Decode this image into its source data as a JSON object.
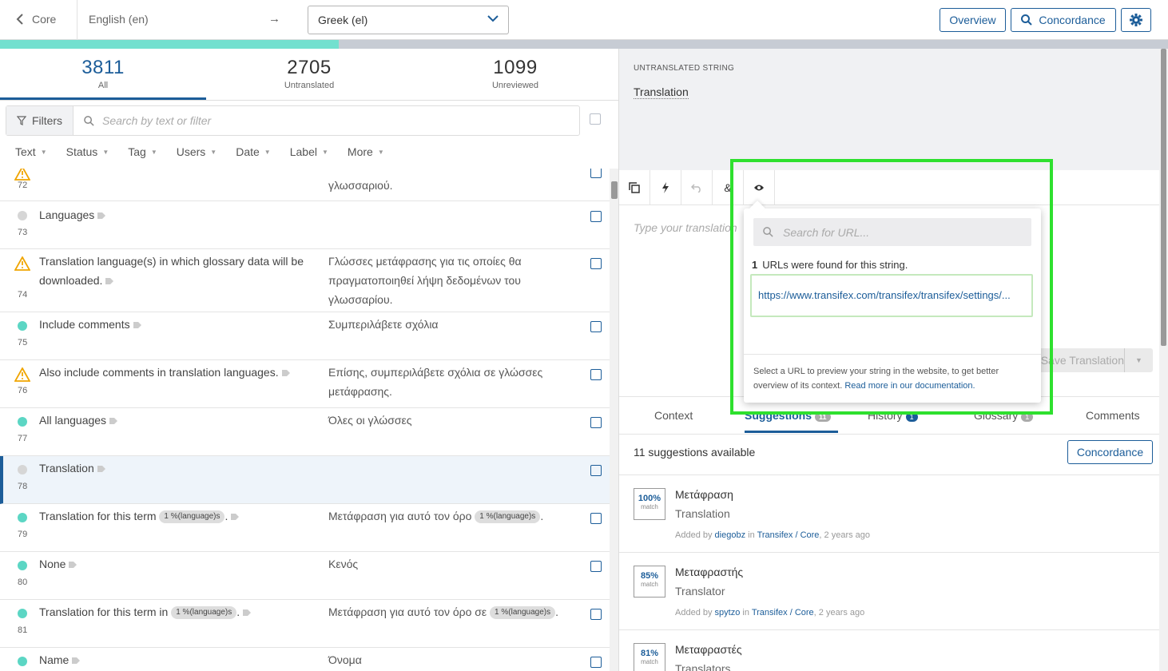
{
  "header": {
    "back_label": "Core",
    "source_language": "English (en)",
    "arrow": "→",
    "target_language": "Greek (el)",
    "overview_label": "Overview",
    "concordance_label": "Concordance"
  },
  "progress": {
    "translated_fraction": 0.29
  },
  "stats": [
    {
      "value": "3811",
      "label": "All"
    },
    {
      "value": "2705",
      "label": "Untranslated"
    },
    {
      "value": "1099",
      "label": "Unreviewed"
    }
  ],
  "filters": {
    "button_label": "Filters",
    "search_placeholder": "Search by text or filter"
  },
  "facets": [
    "Text",
    "Status",
    "Tag",
    "Users",
    "Date",
    "Label",
    "More"
  ],
  "rows": [
    {
      "index": "72",
      "status": "warning",
      "source": "",
      "target": "γλωσσαριού."
    },
    {
      "index": "73",
      "status": "none",
      "source": "Languages",
      "target": ""
    },
    {
      "index": "74",
      "status": "warning",
      "source": "Translation language(s) in which glossary data will be downloaded.",
      "target": "Γλώσσες μετάφρασης για τις οποίες θα πραγματοποιηθεί λήψη δεδομένων του γλωσσαρίου."
    },
    {
      "index": "75",
      "status": "translated",
      "source": "Include comments",
      "target": "Συμπεριλάβετε σχόλια"
    },
    {
      "index": "76",
      "status": "warning",
      "source": "Also include comments in translation languages.",
      "target": "Επίσης, συμπεριλάβετε σχόλια σε γλώσσες μετάφρασης."
    },
    {
      "index": "77",
      "status": "translated",
      "source": "All languages",
      "target": "Όλες οι γλώσσες"
    },
    {
      "index": "78",
      "status": "none",
      "source": "Translation",
      "target": ""
    },
    {
      "index": "79",
      "status": "translated",
      "source": "Translation for this term",
      "source_ph": "1 %(language)s",
      "source_tail": ".",
      "target": "Μετάφραση για αυτό τον όρο",
      "target_ph": "1 %(language)s",
      "target_tail": "."
    },
    {
      "index": "80",
      "status": "translated",
      "source": "None",
      "target": "Κενός"
    },
    {
      "index": "81",
      "status": "translated",
      "source": "Translation for this term in",
      "source_ph": "1 %(language)s",
      "source_tail": ".",
      "target": "Μετάφραση για αυτό τον όρο σε",
      "target_ph": "1 %(language)s",
      "target_tail": "."
    },
    {
      "index": "",
      "status": "translated",
      "source": "Name",
      "target": "Όνομα"
    }
  ],
  "editor": {
    "source_caption": "UNTRANSLATED STRING",
    "source_text": "Translation",
    "translation_placeholder": "Type your translation",
    "save_label": "Save Translation"
  },
  "popover": {
    "search_placeholder": "Search for URL...",
    "found_count": "1",
    "found_text": "URLs were found for this string.",
    "url": "https://www.transifex.com/transifex/transifex/settings/...",
    "footer_text": "Select a URL to preview your string in the website, to get better overview of its context.",
    "footer_link": "Read more in our documentation."
  },
  "tabs": [
    {
      "label": "Context",
      "badge": ""
    },
    {
      "label": "Suggestions",
      "badge": "11"
    },
    {
      "label": "History",
      "badge": "1"
    },
    {
      "label": "Glossary",
      "badge": "1"
    },
    {
      "label": "Comments",
      "badge": ""
    }
  ],
  "suggestions_header": "11 suggestions available",
  "suggestions_concordance": "Concordance",
  "suggestions": [
    {
      "pct": "100%",
      "match": "match",
      "translation": "Μετάφραση",
      "source": "Translation",
      "added_by": "Added by",
      "user": "diegobz",
      "in": "in",
      "project": "Transifex / Core",
      "age": ", 2 years ago"
    },
    {
      "pct": "85%",
      "match": "match",
      "translation": "Μεταφραστής",
      "source": "Translator",
      "added_by": "Added by",
      "user": "spytzo",
      "in": "in",
      "project": "Transifex / Core",
      "age": ", 2 years ago"
    },
    {
      "pct": "81%",
      "match": "match",
      "translation": "Μεταφραστές",
      "source": "Translators",
      "added_by": "",
      "user": "",
      "in": "",
      "project": "",
      "age": ""
    }
  ],
  "colors": {
    "accent": "#1c5d99",
    "translated": "#5cd6c4",
    "warning": "#f0a500",
    "untranslated": "#d6d6d6",
    "highlight": "#2ee02e"
  }
}
